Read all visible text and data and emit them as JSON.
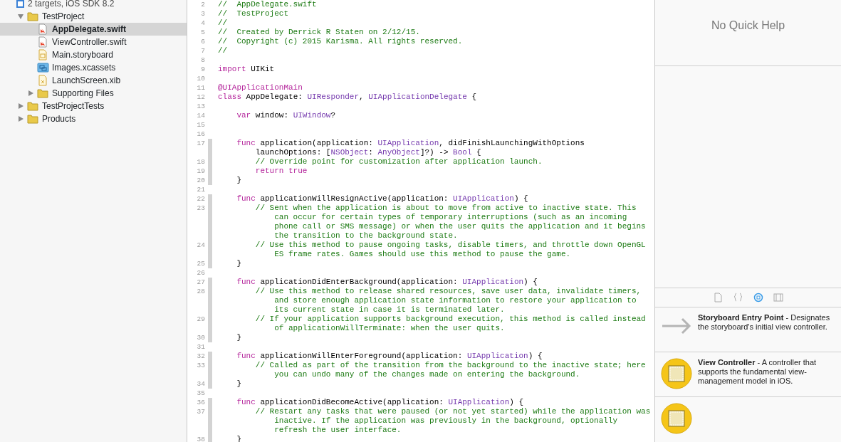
{
  "navigator": {
    "items": [
      {
        "subtitle": "2 targets, iOS SDK 8.2",
        "children": [
          {
            "label": "TestProject",
            "kind": "folder",
            "expanded": true,
            "selected": false,
            "children": [
              {
                "label": "AppDelegate.swift",
                "kind": "swift",
                "selected": true
              },
              {
                "label": "ViewController.swift",
                "kind": "swift",
                "selected": false
              },
              {
                "label": "Main.storyboard",
                "kind": "storyboard",
                "selected": false
              },
              {
                "label": "Images.xcassets",
                "kind": "assets",
                "selected": false
              },
              {
                "label": "LaunchScreen.xib",
                "kind": "xib",
                "selected": false
              },
              {
                "label": "Supporting Files",
                "kind": "folder",
                "expanded": false,
                "selected": false
              }
            ]
          },
          {
            "label": "TestProjectTests",
            "kind": "folder",
            "expanded": false,
            "selected": false
          },
          {
            "label": "Products",
            "kind": "folder",
            "expanded": false,
            "selected": false
          }
        ]
      }
    ]
  },
  "editor": {
    "rows": [
      {
        "number": "2",
        "changed": false,
        "tokens": [
          {
            "kind": "comment",
            "text": "//  AppDelegate.swift"
          }
        ]
      },
      {
        "number": "3",
        "changed": false,
        "tokens": [
          {
            "kind": "comment",
            "text": "//  TestProject"
          }
        ]
      },
      {
        "number": "4",
        "changed": false,
        "tokens": [
          {
            "kind": "comment",
            "text": "//"
          }
        ]
      },
      {
        "number": "5",
        "changed": false,
        "tokens": [
          {
            "kind": "comment",
            "text": "//  Created by Derrick R Staten on 2/12/15."
          }
        ]
      },
      {
        "number": "6",
        "changed": false,
        "tokens": [
          {
            "kind": "comment",
            "text": "//  Copyright (c) 2015 Karisma. All rights reserved."
          }
        ]
      },
      {
        "number": "7",
        "changed": false,
        "tokens": [
          {
            "kind": "comment",
            "text": "//"
          }
        ]
      },
      {
        "number": "8",
        "changed": false
      },
      {
        "number": "9",
        "changed": false,
        "tokens": [
          {
            "kind": "keyword",
            "text": "import"
          },
          {
            "kind": "plain",
            "text": " UIKit"
          }
        ]
      },
      {
        "number": "10",
        "changed": false
      },
      {
        "number": "11",
        "changed": false,
        "tokens": [
          {
            "kind": "keyword",
            "text": "@UIApplicationMain"
          }
        ]
      },
      {
        "number": "12",
        "changed": false,
        "tokens": [
          {
            "kind": "keyword",
            "text": "class"
          },
          {
            "kind": "plain",
            "text": " AppDelegate: "
          },
          {
            "kind": "type",
            "text": "UIResponder"
          },
          {
            "kind": "plain",
            "text": ", "
          },
          {
            "kind": "type",
            "text": "UIApplicationDelegate"
          },
          {
            "kind": "plain",
            "text": " {"
          }
        ]
      },
      {
        "number": "13",
        "changed": false
      },
      {
        "number": "14",
        "changed": false,
        "tokens": [
          {
            "kind": "keyword",
            "text": "    var"
          },
          {
            "kind": "plain",
            "text": " window: "
          },
          {
            "kind": "type",
            "text": "UIWindow"
          },
          {
            "kind": "plain",
            "text": "?"
          }
        ]
      },
      {
        "number": "15",
        "changed": false
      },
      {
        "number": "16",
        "changed": false
      },
      {
        "number": "17",
        "changed": true,
        "tokens": [
          {
            "kind": "keyword",
            "text": "    func"
          },
          {
            "kind": "plain",
            "text": " application(application: "
          },
          {
            "kind": "type",
            "text": "UIApplication"
          },
          {
            "kind": "plain",
            "text": ", didFinishLaunchingWithOptions"
          }
        ]
      },
      {
        "changed": true,
        "tokens": [
          {
            "kind": "plain",
            "text": "        launchOptions: ["
          },
          {
            "kind": "type",
            "text": "NSObject"
          },
          {
            "kind": "plain",
            "text": ": "
          },
          {
            "kind": "type",
            "text": "AnyObject"
          },
          {
            "kind": "plain",
            "text": "]?) -> "
          },
          {
            "kind": "type",
            "text": "Bool"
          },
          {
            "kind": "plain",
            "text": " {"
          }
        ]
      },
      {
        "number": "18",
        "changed": true,
        "tokens": [
          {
            "kind": "comment",
            "text": "        // Override point for customization after application launch."
          }
        ]
      },
      {
        "number": "19",
        "changed": true,
        "tokens": [
          {
            "kind": "keyword",
            "text": "        return true"
          }
        ]
      },
      {
        "number": "20",
        "changed": true,
        "tokens": [
          {
            "kind": "plain",
            "text": "    }"
          }
        ]
      },
      {
        "number": "21",
        "changed": false
      },
      {
        "number": "22",
        "changed": true,
        "tokens": [
          {
            "kind": "keyword",
            "text": "    func"
          },
          {
            "kind": "plain",
            "text": " applicationWillResignActive(application: "
          },
          {
            "kind": "type",
            "text": "UIApplication"
          },
          {
            "kind": "plain",
            "text": ") {"
          }
        ]
      },
      {
        "number": "23",
        "changed": true,
        "tokens": [
          {
            "kind": "comment",
            "text": "        // Sent when the application is about to move from active to inactive state. This"
          }
        ]
      },
      {
        "changed": true,
        "tokens": [
          {
            "kind": "comment",
            "text": "            can occur for certain types of temporary interruptions (such as an incoming"
          }
        ]
      },
      {
        "changed": true,
        "tokens": [
          {
            "kind": "comment",
            "text": "            phone call or SMS message) or when the user quits the application and it begins"
          }
        ]
      },
      {
        "changed": true,
        "tokens": [
          {
            "kind": "comment",
            "text": "            the transition to the background state."
          }
        ]
      },
      {
        "number": "24",
        "changed": true,
        "tokens": [
          {
            "kind": "comment",
            "text": "        // Use this method to pause ongoing tasks, disable timers, and throttle down OpenGL"
          }
        ]
      },
      {
        "changed": true,
        "tokens": [
          {
            "kind": "comment",
            "text": "            ES frame rates. Games should use this method to pause the game."
          }
        ]
      },
      {
        "number": "25",
        "changed": true,
        "tokens": [
          {
            "kind": "plain",
            "text": "    }"
          }
        ]
      },
      {
        "number": "26",
        "changed": false
      },
      {
        "number": "27",
        "changed": true,
        "tokens": [
          {
            "kind": "keyword",
            "text": "    func"
          },
          {
            "kind": "plain",
            "text": " applicationDidEnterBackground(application: "
          },
          {
            "kind": "type",
            "text": "UIApplication"
          },
          {
            "kind": "plain",
            "text": ") {"
          }
        ]
      },
      {
        "number": "28",
        "changed": true,
        "tokens": [
          {
            "kind": "comment",
            "text": "        // Use this method to release shared resources, save user data, invalidate timers,"
          }
        ]
      },
      {
        "changed": true,
        "tokens": [
          {
            "kind": "comment",
            "text": "            and store enough application state information to restore your application to"
          }
        ]
      },
      {
        "changed": true,
        "tokens": [
          {
            "kind": "comment",
            "text": "            its current state in case it is terminated later."
          }
        ]
      },
      {
        "number": "29",
        "changed": true,
        "tokens": [
          {
            "kind": "comment",
            "text": "        // If your application supports background execution, this method is called instead"
          }
        ]
      },
      {
        "changed": true,
        "tokens": [
          {
            "kind": "comment",
            "text": "            of applicationWillTerminate: when the user quits."
          }
        ]
      },
      {
        "number": "30",
        "changed": true,
        "tokens": [
          {
            "kind": "plain",
            "text": "    }"
          }
        ]
      },
      {
        "number": "31",
        "changed": false
      },
      {
        "number": "32",
        "changed": true,
        "tokens": [
          {
            "kind": "keyword",
            "text": "    func"
          },
          {
            "kind": "plain",
            "text": " applicationWillEnterForeground(application: "
          },
          {
            "kind": "type",
            "text": "UIApplication"
          },
          {
            "kind": "plain",
            "text": ") {"
          }
        ]
      },
      {
        "number": "33",
        "changed": true,
        "tokens": [
          {
            "kind": "comment",
            "text": "        // Called as part of the transition from the background to the inactive state; here"
          }
        ]
      },
      {
        "changed": true,
        "tokens": [
          {
            "kind": "comment",
            "text": "            you can undo many of the changes made on entering the background."
          }
        ]
      },
      {
        "number": "34",
        "changed": true,
        "tokens": [
          {
            "kind": "plain",
            "text": "    }"
          }
        ]
      },
      {
        "number": "35",
        "changed": false
      },
      {
        "number": "36",
        "changed": true,
        "tokens": [
          {
            "kind": "keyword",
            "text": "    func"
          },
          {
            "kind": "plain",
            "text": " applicationDidBecomeActive(application: "
          },
          {
            "kind": "type",
            "text": "UIApplication"
          },
          {
            "kind": "plain",
            "text": ") {"
          }
        ]
      },
      {
        "number": "37",
        "changed": true,
        "tokens": [
          {
            "kind": "comment",
            "text": "        // Restart any tasks that were paused (or not yet started) while the application was"
          }
        ]
      },
      {
        "changed": true,
        "tokens": [
          {
            "kind": "comment",
            "text": "            inactive. If the application was previously in the background, optionally"
          }
        ]
      },
      {
        "changed": true,
        "tokens": [
          {
            "kind": "comment",
            "text": "            refresh the user interface."
          }
        ]
      },
      {
        "number": "38",
        "changed": true,
        "tokens": [
          {
            "kind": "plain",
            "text": "    }"
          }
        ]
      }
    ]
  },
  "inspector": {
    "quick_help": "No Quick Help",
    "library_tabs": [
      {
        "kind": "file",
        "selected": false
      },
      {
        "kind": "braces",
        "selected": false
      },
      {
        "kind": "object",
        "selected": true
      },
      {
        "kind": "media",
        "selected": false
      }
    ],
    "library_items": [
      {
        "kind": "entry",
        "title": "Storyboard Entry Point",
        "description": " - Designates the storyboard's initial view controller."
      },
      {
        "kind": "controller",
        "title": "View Controller",
        "description": " - A controller that supports the fundamental view-management model in iOS."
      },
      {
        "kind": "controller"
      }
    ]
  }
}
